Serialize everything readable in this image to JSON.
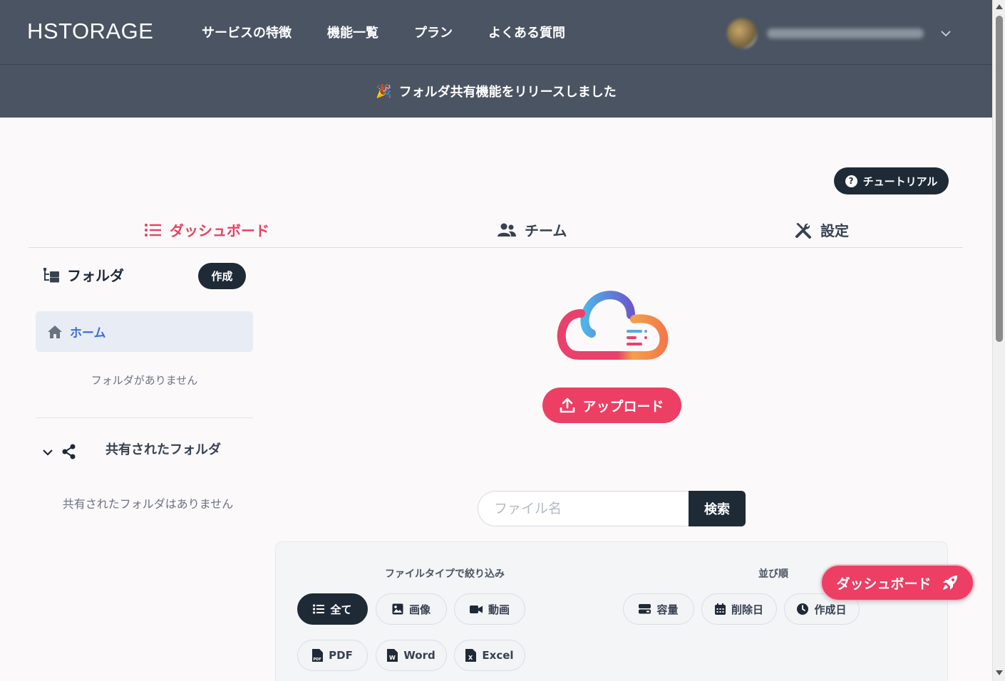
{
  "nav": {
    "logo": "HSTORAGE",
    "links": [
      "サービスの特徴",
      "機能一覧",
      "プラン",
      "よくある質問"
    ]
  },
  "banner": {
    "icon": "party-popper-icon",
    "text": "フォルダ共有機能をリリースしました"
  },
  "tutorial": {
    "label": "チュートリアル"
  },
  "tabs": [
    {
      "label": "ダッシュボード",
      "icon": "list-icon"
    },
    {
      "label": "チーム",
      "icon": "users-icon"
    },
    {
      "label": "設定",
      "icon": "tools-icon"
    }
  ],
  "sidebar": {
    "folder_title": "フォルダ",
    "create_label": "作成",
    "home_label": "ホーム",
    "no_folders": "フォルダがありません",
    "shared_title": "共有されたフォルダ",
    "no_shared": "共有されたフォルダはありません"
  },
  "upload": {
    "label": "アップロード"
  },
  "search": {
    "placeholder": "ファイル名",
    "button": "検索"
  },
  "filters": {
    "type_label": "ファイルタイプで絞り込み",
    "sort_label": "並び順",
    "types": [
      "全て",
      "画像",
      "動画",
      "PDF",
      "Word",
      "Excel"
    ],
    "sorts": [
      "容量",
      "削除日",
      "作成日"
    ]
  },
  "float_button": {
    "label": "ダッシュボード"
  },
  "colors": {
    "accent": "#ec3f63",
    "dark": "#1f2a37",
    "nav": "#4a5462",
    "link_blue": "#3b6fd6"
  }
}
